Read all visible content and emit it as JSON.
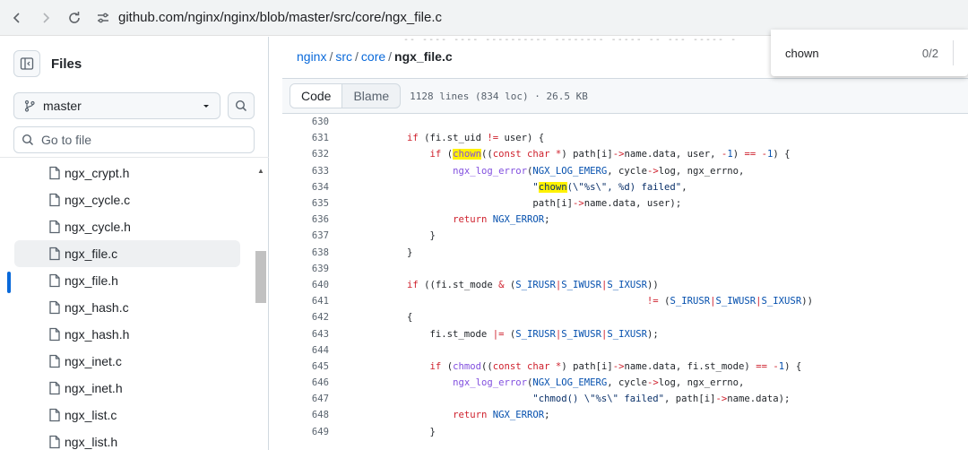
{
  "browser": {
    "url": "github.com/nginx/nginx/blob/master/src/core/ngx_file.c"
  },
  "sidebar": {
    "title": "Files",
    "branch": "master",
    "goto_placeholder": "Go to file",
    "files": [
      {
        "name": "ngx_crypt.h",
        "active": false
      },
      {
        "name": "ngx_cycle.c",
        "active": false
      },
      {
        "name": "ngx_cycle.h",
        "active": false
      },
      {
        "name": "ngx_file.c",
        "active": true
      },
      {
        "name": "ngx_file.h",
        "active": false
      },
      {
        "name": "ngx_hash.c",
        "active": false
      },
      {
        "name": "ngx_hash.h",
        "active": false
      },
      {
        "name": "ngx_inet.c",
        "active": false
      },
      {
        "name": "ngx_inet.h",
        "active": false
      },
      {
        "name": "ngx_list.c",
        "active": false
      },
      {
        "name": "ngx_list.h",
        "active": false
      }
    ]
  },
  "breadcrumb": {
    "repo": "nginx",
    "dir1": "src",
    "dir2": "core",
    "file": "ngx_file.c"
  },
  "toolbar": {
    "code_tab": "Code",
    "blame_tab": "Blame",
    "file_info": "1128 lines (834 loc) · 26.5 KB"
  },
  "find": {
    "query": "chown",
    "count": "0/2"
  },
  "code": {
    "lines": [
      {
        "n": "630",
        "src": ""
      },
      {
        "n": "631",
        "src": "        if (fi.st_uid != user) {"
      },
      {
        "n": "632",
        "src": "            if (chown((const char *) path[i]->name.data, user, -1) == -1) {"
      },
      {
        "n": "633",
        "src": "                ngx_log_error(NGX_LOG_EMERG, cycle->log, ngx_errno,"
      },
      {
        "n": "634",
        "src": "                              \"chown(\\\"%s\\\", %d) failed\","
      },
      {
        "n": "635",
        "src": "                              path[i]->name.data, user);"
      },
      {
        "n": "636",
        "src": "                return NGX_ERROR;"
      },
      {
        "n": "637",
        "src": "            }"
      },
      {
        "n": "638",
        "src": "        }"
      },
      {
        "n": "639",
        "src": ""
      },
      {
        "n": "640",
        "src": "        if ((fi.st_mode & (S_IRUSR|S_IWUSR|S_IXUSR))"
      },
      {
        "n": "641",
        "src": "                                                  != (S_IRUSR|S_IWUSR|S_IXUSR))"
      },
      {
        "n": "642",
        "src": "        {"
      },
      {
        "n": "643",
        "src": "            fi.st_mode |= (S_IRUSR|S_IWUSR|S_IXUSR);"
      },
      {
        "n": "644",
        "src": ""
      },
      {
        "n": "645",
        "src": "            if (chmod((const char *) path[i]->name.data, fi.st_mode) == -1) {"
      },
      {
        "n": "646",
        "src": "                ngx_log_error(NGX_LOG_EMERG, cycle->log, ngx_errno,"
      },
      {
        "n": "647",
        "src": "                              \"chmod() \\\"%s\\\" failed\", path[i]->name.data);"
      },
      {
        "n": "648",
        "src": "                return NGX_ERROR;"
      },
      {
        "n": "649",
        "src": "            }"
      }
    ]
  },
  "colors": {
    "link": "#0969da",
    "highlight": "#fff200",
    "keyword": "#cf222e",
    "function": "#8250df",
    "string": "#0a3069",
    "constant": "#0550ae"
  }
}
